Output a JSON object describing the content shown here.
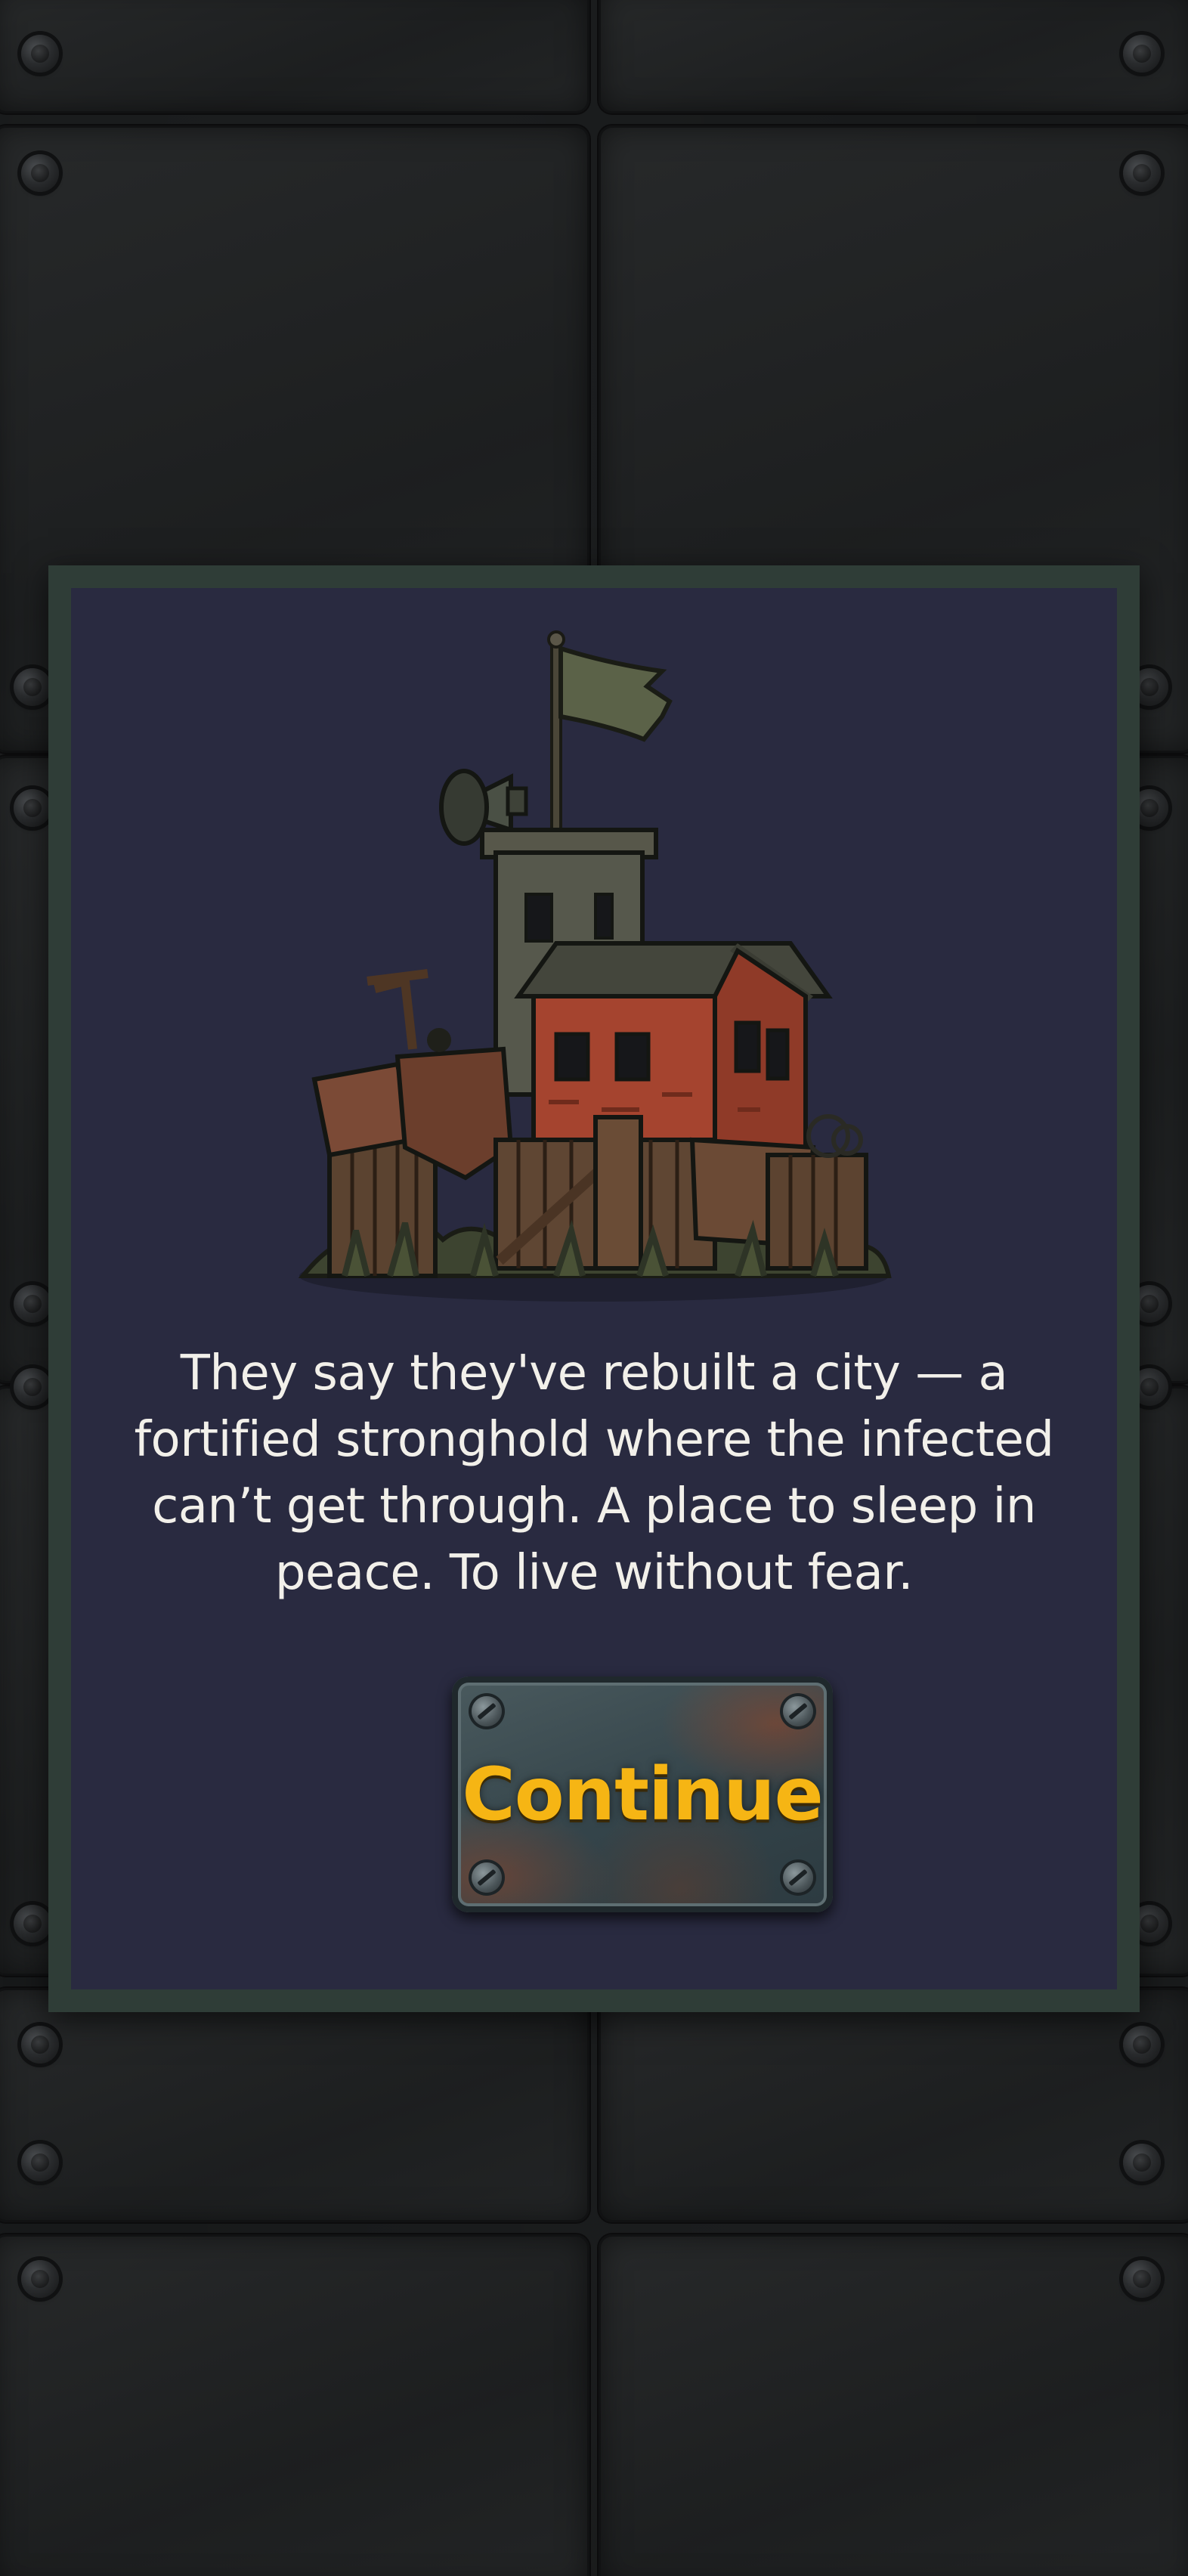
{
  "story": {
    "message": "They say they've rebuilt a city — a fortified stronghold where the infected can’t get through. A place to sleep in peace. To live without fear.",
    "illustration_icon": "fortified-outpost-illustration"
  },
  "actions": {
    "continue_label": "Continue"
  },
  "colors": {
    "dialog_border": "#2f3d37",
    "dialog_background": "#292a40",
    "text": "#f2f0ea",
    "button_text": "#f6b514",
    "background": "#17191a"
  }
}
